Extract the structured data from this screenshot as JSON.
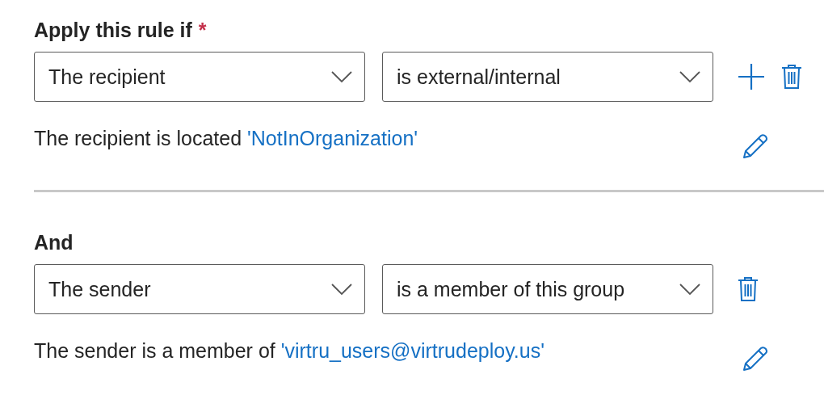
{
  "sections": [
    {
      "heading": "Apply this rule if",
      "required_mark": "*",
      "property": "The recipient",
      "operator": "is external/internal",
      "actions": [
        {
          "kind": "add"
        },
        {
          "kind": "delete"
        }
      ],
      "description": "The recipient is located ",
      "value_link": "'NotInOrganization'"
    },
    {
      "heading": "And",
      "property": "The sender",
      "operator": "is a member of this group",
      "actions": [
        {
          "kind": "delete"
        }
      ],
      "description": "The sender is a member of ",
      "value_link": "'virtru_users@virtrudeploy.us'"
    }
  ]
}
